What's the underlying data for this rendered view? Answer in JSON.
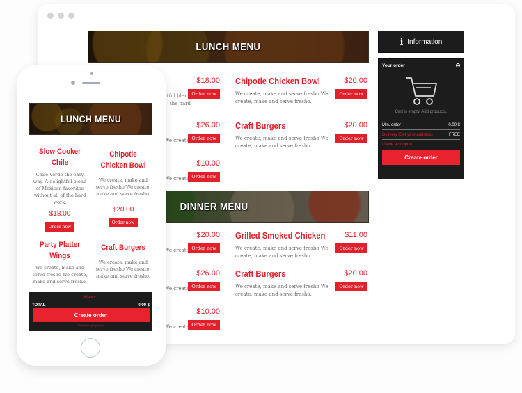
{
  "colors": {
    "accent": "#e2202b",
    "panel": "#1c1c1c",
    "text_muted": "#6b6b6b"
  },
  "desktop": {
    "lunch_menu": {
      "title": "LUNCH MENU",
      "left_items": [
        {
          "price": "$18.00",
          "desc_tail": "tful blend\nthe hard",
          "button": "Order now"
        },
        {
          "price": "$26.00",
          "desc_tail": "We create,",
          "button": "Order now"
        },
        {
          "price": "$10.00",
          "desc_tail": "We create,",
          "button": "Order now"
        }
      ],
      "right_items": [
        {
          "name": "Chipotle Chicken Bowl",
          "price": "$20.00",
          "desc": "We create, make and serve fresho We create, make and serve fresho.",
          "button": "Order now"
        },
        {
          "name": "Craft Burgers",
          "price": "$20.00",
          "desc": "We create, make and serve fresho We create, make and serve fresho.",
          "button": "Order now"
        }
      ]
    },
    "dinner_menu": {
      "title": "DINNER MENU",
      "left_items": [
        {
          "price": "$20.00",
          "desc_tail": "We create,",
          "button": "Order now"
        },
        {
          "price": "$26.00",
          "desc_tail": "We create,",
          "button": "Order now"
        },
        {
          "price": "$10.00",
          "desc_tail": "We create,",
          "button": "Order now"
        }
      ],
      "right_items": [
        {
          "name": "Grilled Smoked Chicken",
          "price": "$11.00",
          "desc": "We create, make and serve fresho We create, make and serve fresho.",
          "button": "Order now"
        },
        {
          "name": "Craft Burgers",
          "price": "$20.00",
          "desc": "We create, make and serve fresho We create, make and serve fresho.",
          "button": "Order now"
        }
      ]
    },
    "sidebar": {
      "info_icon": "i",
      "info_label": "Information",
      "order_title": "Your order",
      "cart_empty": "Cart is empty. Add products.",
      "min_order_label": "Min. order",
      "min_order_value": "0.00 $",
      "delivery_label": "Delivery (Set your address)",
      "delivery_value": "FREE",
      "coupon_label": "I have a coupon",
      "create_order": "Create order"
    }
  },
  "mobile": {
    "menu_title": "LUNCH MENU",
    "items": [
      {
        "name": "Slow Cooker Chile",
        "desc": "Chile Verde the easy way. A delightful blend of Mexican favorites without all of the hard work.",
        "price": "$18.00",
        "button": "Order now"
      },
      {
        "name": "Chipotle Chicken Bowl",
        "desc": "We create, make and serve fresho We create, make and serve fresho.",
        "price": "$20.00",
        "button": "Order now"
      },
      {
        "name": "Party Platter Wings",
        "desc": "We create, make and serve fresho We create, make and serve fresho."
      },
      {
        "name": "Craft Burgers",
        "desc": "We create, make and serve fresho We create, make and serve fresho."
      }
    ],
    "footer": {
      "menu_toggle": "Menu ^",
      "total_label": "TOTAL",
      "total_value": "0.00 $",
      "create_order": "Create order",
      "powered_by": "Powered by Upmenu"
    }
  }
}
